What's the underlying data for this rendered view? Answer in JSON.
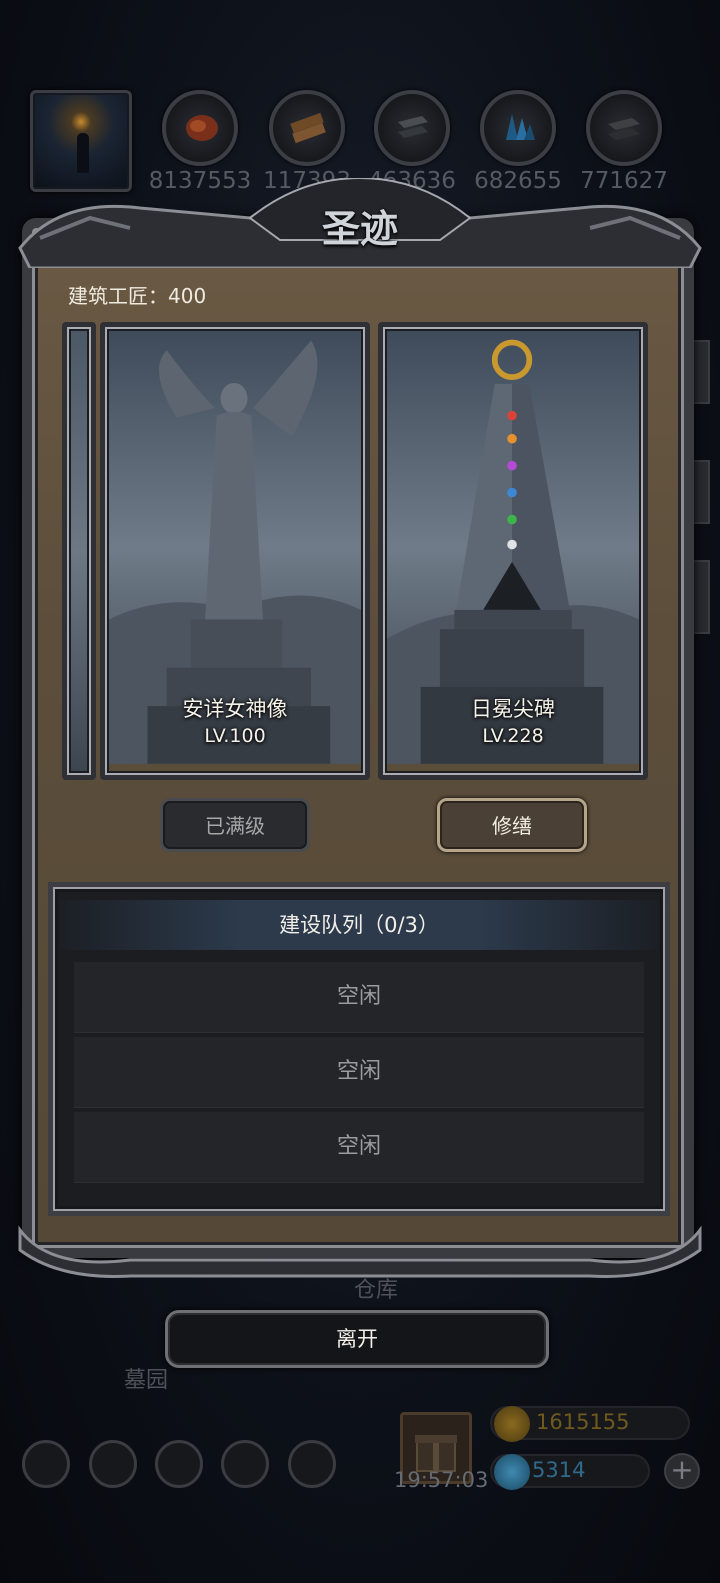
{
  "resources": {
    "values": [
      "8137553",
      "117393",
      "463636",
      "682655",
      "771627"
    ],
    "icons": [
      "meat-icon",
      "wood-icon",
      "iron-icon",
      "crystal-icon",
      "stone-icon"
    ]
  },
  "dialog": {
    "title": "圣迹",
    "craftsmen_label": "建筑工匠：400",
    "cards": [
      {
        "name": "安详女神像",
        "level": "LV.100",
        "button": "已满级"
      },
      {
        "name": "日冕尖碑",
        "level": "LV.228",
        "button": "修缮"
      }
    ],
    "queue": {
      "title": "建设队列（0/3）",
      "slots": [
        "空闲",
        "空闲",
        "空闲"
      ]
    },
    "leave_label": "离开"
  },
  "background": {
    "labels": [
      "仓库",
      "墓园"
    ],
    "clock": "19:57:03",
    "gold": "1615155",
    "diamonds": "5314",
    "plus": "+"
  },
  "colors": {
    "panel": "#5c4e3b",
    "repair_border": "#b5a58a",
    "gold_text": "#6e5a1e",
    "diamond_text": "#2f6a8c"
  }
}
